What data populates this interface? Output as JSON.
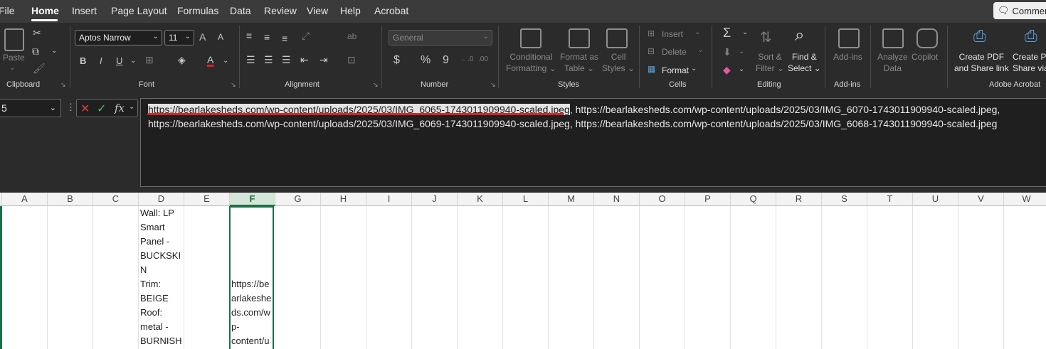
{
  "menubar": {
    "tabs": [
      "File",
      "Home",
      "Insert",
      "Page Layout",
      "Formulas",
      "Data",
      "Review",
      "View",
      "Help",
      "Acrobat"
    ],
    "active_tab": "Home",
    "comments_label": "Comment"
  },
  "ribbon": {
    "clipboard": {
      "label": "Clipboard",
      "paste": "Paste"
    },
    "font": {
      "label": "Font",
      "family": "Aptos Narrow",
      "size": "11",
      "bold": "B",
      "italic": "I",
      "underline": "U",
      "grow": "A",
      "shrink": "A",
      "font_color_letter": "A"
    },
    "alignment": {
      "label": "Alignment"
    },
    "number": {
      "label": "Number",
      "format": "General",
      "currency": "$",
      "percent": "%",
      "comma": "9"
    },
    "styles": {
      "label": "Styles",
      "conditional": [
        "Conditional",
        "Formatting"
      ],
      "format_as_table": [
        "Format as",
        "Table"
      ],
      "cell_styles": [
        "Cell",
        "Styles"
      ]
    },
    "cells": {
      "label": "Cells",
      "insert": "Insert",
      "delete": "Delete",
      "format": "Format"
    },
    "editing": {
      "label": "Editing",
      "sum": "Σ",
      "sort_filter": [
        "Sort &",
        "Filter"
      ],
      "find_select": [
        "Find &",
        "Select"
      ]
    },
    "addins": {
      "label": "Add-ins",
      "addins": "Add-ins"
    },
    "analysis": {
      "analyze": [
        "Analyze",
        "Data"
      ],
      "copilot": "Copilot"
    },
    "acrobat": {
      "label": "Adobe Acrobat",
      "create_pdf": [
        "Create PDF",
        "and Share link"
      ],
      "create_pdf2": [
        "Create P",
        "Share via"
      ]
    }
  },
  "formula_bar": {
    "name_box": "5",
    "fx": "fx",
    "line1_selected": "https://bearlakesheds.com/wp-content/uploads/2025/03/IMG_6065-1743011909940-scaled.jpeg",
    "line1_rest": ", https://bearlakesheds.com/wp-content/uploads/2025/03/IMG_6070-1743011909940-scaled.jpeg,",
    "line2": "https://bearlakesheds.com/wp-content/uploads/2025/03/IMG_6069-1743011909940-scaled.jpeg, https://bearlakesheds.com/wp-content/uploads/2025/03/IMG_6068-1743011909940-scaled.jpeg"
  },
  "grid": {
    "columns": [
      "A",
      "B",
      "C",
      "D",
      "E",
      "F",
      "G",
      "H",
      "I",
      "J",
      "K",
      "L",
      "M",
      "N",
      "O",
      "P",
      "Q",
      "R",
      "S",
      "T",
      "U",
      "V",
      "W"
    ],
    "selected_column": "F",
    "cell_D": "Wall: LP\nSmart\nPanel -\nBUCKSKI\nN\nTrim:\nBEIGE\nRoof:\nmetal -\nBURNISH",
    "cell_F": "https://be\narlakeshe\nds.com/w\np-\ncontent/u"
  },
  "colors": {
    "selection_green": "#1e7145",
    "underline_red": "#dd2222"
  }
}
